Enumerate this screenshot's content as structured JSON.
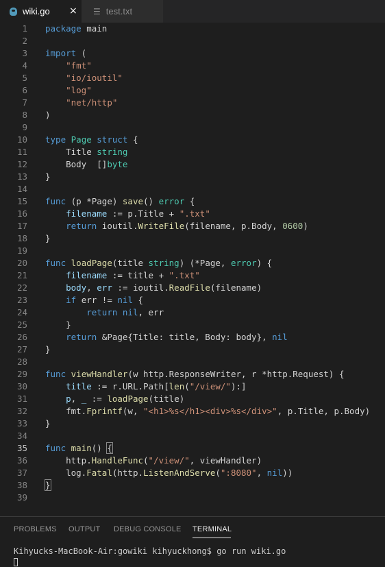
{
  "tabs": [
    {
      "label": "wiki.go",
      "active": true,
      "icon": "go-file-icon"
    },
    {
      "label": "test.txt",
      "active": false,
      "icon": "text-file-icon"
    }
  ],
  "close_glyph": "×",
  "editor": {
    "active_line": 35,
    "lines": [
      {
        "n": "1",
        "code": [
          [
            "k",
            "package"
          ],
          [
            "d",
            " main"
          ]
        ]
      },
      {
        "n": "2",
        "code": []
      },
      {
        "n": "3",
        "code": [
          [
            "k",
            "import"
          ],
          [
            "d",
            " ("
          ]
        ]
      },
      {
        "n": "4",
        "code": [
          [
            "d",
            "    "
          ],
          [
            "s",
            "\"fmt\""
          ]
        ]
      },
      {
        "n": "5",
        "code": [
          [
            "d",
            "    "
          ],
          [
            "s",
            "\"io/ioutil\""
          ]
        ]
      },
      {
        "n": "6",
        "code": [
          [
            "d",
            "    "
          ],
          [
            "s",
            "\"log\""
          ]
        ]
      },
      {
        "n": "7",
        "code": [
          [
            "d",
            "    "
          ],
          [
            "s",
            "\"net/http\""
          ]
        ]
      },
      {
        "n": "8",
        "code": [
          [
            "d",
            ")"
          ]
        ]
      },
      {
        "n": "9",
        "code": []
      },
      {
        "n": "10",
        "code": [
          [
            "k",
            "type"
          ],
          [
            "d",
            " "
          ],
          [
            "t",
            "Page"
          ],
          [
            "d",
            " "
          ],
          [
            "k",
            "struct"
          ],
          [
            "d",
            " {"
          ]
        ]
      },
      {
        "n": "11",
        "code": [
          [
            "d",
            "    Title "
          ],
          [
            "t",
            "string"
          ]
        ]
      },
      {
        "n": "12",
        "code": [
          [
            "d",
            "    Body  []"
          ],
          [
            "t",
            "byte"
          ]
        ]
      },
      {
        "n": "13",
        "code": [
          [
            "d",
            "}"
          ]
        ]
      },
      {
        "n": "14",
        "code": []
      },
      {
        "n": "15",
        "code": [
          [
            "k",
            "func"
          ],
          [
            "d",
            " (p *Page) "
          ],
          [
            "f",
            "save"
          ],
          [
            "d",
            "() "
          ],
          [
            "t",
            "error"
          ],
          [
            "d",
            " {"
          ]
        ]
      },
      {
        "n": "16",
        "code": [
          [
            "d",
            "    "
          ],
          [
            "v",
            "filename"
          ],
          [
            "d",
            " := p.Title + "
          ],
          [
            "s",
            "\".txt\""
          ]
        ]
      },
      {
        "n": "17",
        "code": [
          [
            "d",
            "    "
          ],
          [
            "k",
            "return"
          ],
          [
            "d",
            " ioutil."
          ],
          [
            "f",
            "WriteFile"
          ],
          [
            "d",
            "(filename, p.Body, "
          ],
          [
            "n",
            "0600"
          ],
          [
            "d",
            ")"
          ]
        ]
      },
      {
        "n": "18",
        "code": [
          [
            "d",
            "}"
          ]
        ]
      },
      {
        "n": "19",
        "code": []
      },
      {
        "n": "20",
        "code": [
          [
            "k",
            "func"
          ],
          [
            "d",
            " "
          ],
          [
            "f",
            "loadPage"
          ],
          [
            "d",
            "(title "
          ],
          [
            "t",
            "string"
          ],
          [
            "d",
            ") (*Page, "
          ],
          [
            "t",
            "error"
          ],
          [
            "d",
            ") {"
          ]
        ]
      },
      {
        "n": "21",
        "code": [
          [
            "d",
            "    "
          ],
          [
            "v",
            "filename"
          ],
          [
            "d",
            " := title + "
          ],
          [
            "s",
            "\".txt\""
          ]
        ]
      },
      {
        "n": "22",
        "code": [
          [
            "d",
            "    "
          ],
          [
            "v",
            "body"
          ],
          [
            "d",
            ", "
          ],
          [
            "v",
            "err"
          ],
          [
            "d",
            " := ioutil."
          ],
          [
            "f",
            "ReadFile"
          ],
          [
            "d",
            "(filename)"
          ]
        ]
      },
      {
        "n": "23",
        "code": [
          [
            "d",
            "    "
          ],
          [
            "k",
            "if"
          ],
          [
            "d",
            " err != "
          ],
          [
            "k",
            "nil"
          ],
          [
            "d",
            " {"
          ]
        ]
      },
      {
        "n": "24",
        "code": [
          [
            "d",
            "        "
          ],
          [
            "k",
            "return"
          ],
          [
            "d",
            " "
          ],
          [
            "k",
            "nil"
          ],
          [
            "d",
            ", err"
          ]
        ]
      },
      {
        "n": "25",
        "code": [
          [
            "d",
            "    }"
          ]
        ]
      },
      {
        "n": "26",
        "code": [
          [
            "d",
            "    "
          ],
          [
            "k",
            "return"
          ],
          [
            "d",
            " &Page{Title: title, Body: body}, "
          ],
          [
            "k",
            "nil"
          ]
        ]
      },
      {
        "n": "27",
        "code": [
          [
            "d",
            "}"
          ]
        ]
      },
      {
        "n": "28",
        "code": []
      },
      {
        "n": "29",
        "code": [
          [
            "k",
            "func"
          ],
          [
            "d",
            " "
          ],
          [
            "f",
            "viewHandler"
          ],
          [
            "d",
            "(w http.ResponseWriter, r *http.Request) {"
          ]
        ]
      },
      {
        "n": "30",
        "code": [
          [
            "d",
            "    "
          ],
          [
            "v",
            "title"
          ],
          [
            "d",
            " := r.URL.Path["
          ],
          [
            "f",
            "len"
          ],
          [
            "d",
            "("
          ],
          [
            "s",
            "\"/view/\""
          ],
          [
            "d",
            ")"
          ],
          [
            "d",
            ":]"
          ]
        ]
      },
      {
        "n": "31",
        "code": [
          [
            "d",
            "    "
          ],
          [
            "v",
            "p"
          ],
          [
            "d",
            ", "
          ],
          [
            "v",
            "_"
          ],
          [
            "d",
            " := "
          ],
          [
            "f",
            "loadPage"
          ],
          [
            "d",
            "(title)"
          ]
        ]
      },
      {
        "n": "32",
        "code": [
          [
            "d",
            "    fmt."
          ],
          [
            "f",
            "Fprintf"
          ],
          [
            "d",
            "(w, "
          ],
          [
            "s",
            "\"<h1>%s</h1><div>%s</div>\""
          ],
          [
            "d",
            ", p.Title, p.Body)"
          ]
        ]
      },
      {
        "n": "33",
        "code": [
          [
            "d",
            "}"
          ]
        ]
      },
      {
        "n": "34",
        "code": []
      },
      {
        "n": "35",
        "code": [
          [
            "k",
            "func"
          ],
          [
            "d",
            " "
          ],
          [
            "f",
            "main"
          ],
          [
            "d",
            "() "
          ],
          [
            "box",
            "{"
          ]
        ]
      },
      {
        "n": "36",
        "code": [
          [
            "d",
            "    http."
          ],
          [
            "f",
            "HandleFunc"
          ],
          [
            "d",
            "("
          ],
          [
            "s",
            "\"/view/\""
          ],
          [
            "d",
            ", viewHandler)"
          ]
        ]
      },
      {
        "n": "37",
        "code": [
          [
            "d",
            "    log."
          ],
          [
            "f",
            "Fatal"
          ],
          [
            "d",
            "(http."
          ],
          [
            "f",
            "ListenAndServe"
          ],
          [
            "d",
            "("
          ],
          [
            "s",
            "\":8080\""
          ],
          [
            "d",
            ", "
          ],
          [
            "k",
            "nil"
          ],
          [
            "d",
            "))"
          ]
        ]
      },
      {
        "n": "38",
        "code": [
          [
            "box",
            "}"
          ]
        ]
      },
      {
        "n": "39",
        "code": []
      }
    ]
  },
  "panel": {
    "tabs": [
      "PROBLEMS",
      "OUTPUT",
      "DEBUG CONSOLE",
      "TERMINAL"
    ],
    "active_tab": "TERMINAL",
    "terminal_text": "Kihyucks-MacBook-Air:gowiki kihyuckhong$ go run wiki.go"
  },
  "colors": {
    "editor_bg": "#1e1e1e",
    "keyword": "#569cd6",
    "type": "#4ec9b0",
    "function": "#dcdcaa",
    "string": "#ce9178",
    "number": "#b5cea8",
    "variable": "#9cdcfe"
  }
}
